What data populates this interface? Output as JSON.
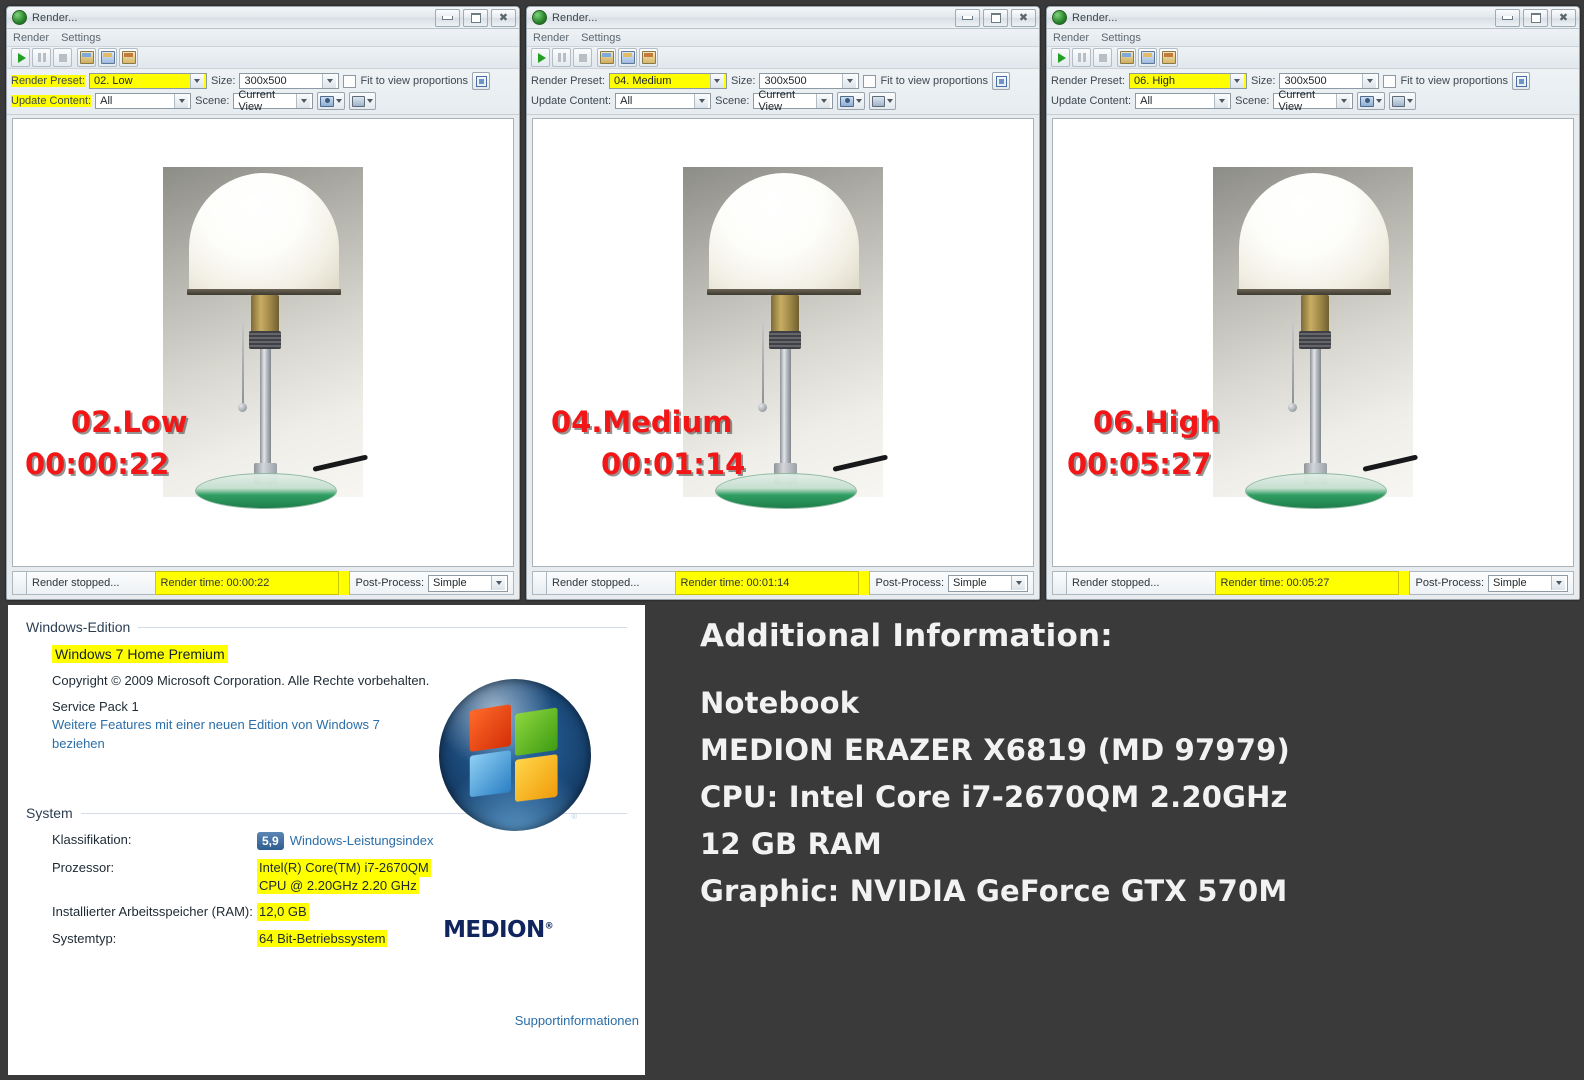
{
  "windows": [
    {
      "title": "Render...",
      "app_icon": "render-app-icon",
      "menus": [
        "Render",
        "Settings"
      ],
      "toolbar_buttons": [
        "play-icon",
        "pause-icon",
        "stop-icon",
        "save-image-icon",
        "copy-image-icon",
        "export-image-icon"
      ],
      "render_preset_label": "Render Preset:",
      "render_preset_value": "02. Low",
      "size_label": "Size:",
      "size_value": "300x500",
      "fit_label": "Fit to view proportions",
      "fit_checked": false,
      "update_label": "Update Content:",
      "update_value": "All",
      "scene_label": "Scene:",
      "scene_value": "Current View",
      "overlay_preset": "02.Low",
      "overlay_time": "00:00:22",
      "status": "Render stopped...",
      "render_time": "Render time: 00:00:22",
      "post_process_label": "Post-Process:",
      "post_process_value": "Simple"
    },
    {
      "title": "Render...",
      "app_icon": "render-app-icon",
      "menus": [
        "Render",
        "Settings"
      ],
      "toolbar_buttons": [
        "play-icon",
        "pause-icon",
        "stop-icon",
        "save-image-icon",
        "copy-image-icon",
        "export-image-icon"
      ],
      "render_preset_label": "Render Preset:",
      "render_preset_value": "04. Medium",
      "size_label": "Size:",
      "size_value": "300x500",
      "fit_label": "Fit to view proportions",
      "fit_checked": false,
      "update_label": "Update Content:",
      "update_value": "All",
      "scene_label": "Scene:",
      "scene_value": "Current View",
      "overlay_preset": "04.Medium",
      "overlay_time": "00:01:14",
      "status": "Render stopped...",
      "render_time": "Render time: 00:01:14",
      "post_process_label": "Post-Process:",
      "post_process_value": "Simple"
    },
    {
      "title": "Render...",
      "app_icon": "render-app-icon",
      "menus": [
        "Render",
        "Settings"
      ],
      "toolbar_buttons": [
        "play-icon",
        "pause-icon",
        "stop-icon",
        "save-image-icon",
        "copy-image-icon",
        "export-image-icon"
      ],
      "render_preset_label": "Render Preset:",
      "render_preset_value": "06. High",
      "size_label": "Size:",
      "size_value": "300x500",
      "fit_label": "Fit to view proportions",
      "fit_checked": false,
      "update_label": "Update Content:",
      "update_value": "All",
      "scene_label": "Scene:",
      "scene_value": "Current View",
      "overlay_preset": "06.High",
      "overlay_time": "00:05:27",
      "status": "Render stopped...",
      "render_time": "Render time: 00:05:27",
      "post_process_label": "Post-Process:",
      "post_process_value": "Simple"
    }
  ],
  "system_properties": {
    "edition_section_title": "Windows-Edition",
    "edition_name": "Windows 7 Home Premium",
    "copyright": "Copyright © 2009 Microsoft Corporation. Alle Rechte vorbehalten.",
    "service_pack": "Service Pack 1",
    "upgrade_link": "Weitere Features mit einer neuen Edition von Windows 7 beziehen",
    "system_section_title": "System",
    "rows": [
      {
        "key": "Klassifikation:",
        "score": "5,9",
        "link": "Windows-Leistungsindex"
      },
      {
        "key": "Prozessor:",
        "value_line1": "Intel(R) Core(TM) i7-2670QM",
        "value_line2": "CPU @ 2.20GHz   2.20 GHz"
      },
      {
        "key": "Installierter Arbeitsspeicher (RAM):",
        "value_line1": "12,0 GB"
      },
      {
        "key": "Systemtyp:",
        "value_line1": "64 Bit-Betriebssystem"
      }
    ],
    "oem_logo": "MEDION",
    "oem_logo_mark": "®",
    "support_link": "Supportinformationen"
  },
  "additional_information": {
    "title": "Additional Information:",
    "lines": [
      "Notebook",
      "MEDION ERAZER X6819 (MD 97979)",
      "CPU: Intel Core i7-2670QM 2.20GHz",
      "12 GB RAM",
      "Graphic:  NVIDIA GeForce GTX 570M"
    ]
  },
  "preview_watermark": "",
  "colors": {
    "highlight": "#ffff00",
    "overlay_red": "#f21616",
    "link_blue": "#2b6ea8",
    "page_background": "#3a3a3a"
  }
}
